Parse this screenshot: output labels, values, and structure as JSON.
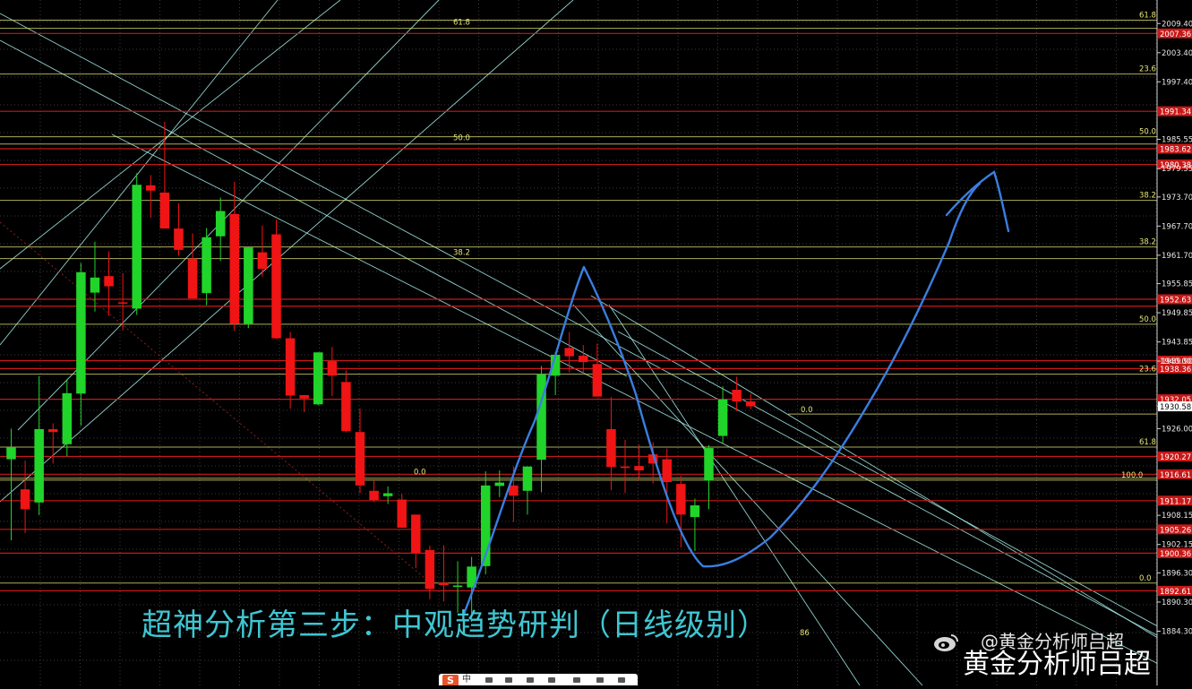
{
  "chart_data": {
    "type": "candlestick",
    "ylim": [
      1884.2,
      2012.4
    ],
    "price_ticks": [
      "2009.40",
      "2003.40",
      "1997.40",
      "1985.55",
      "1979.55",
      "1973.70",
      "1967.70",
      "1961.70",
      "1955.85",
      "1949.85",
      "1943.85",
      "1939.90",
      "1930.58",
      "1926.00",
      "1908.15",
      "1902.15",
      "1896.30",
      "1890.30",
      "1884.30"
    ],
    "red_levels": [
      {
        "value": 2007.36,
        "label": "2007.36",
        "show_label": true
      },
      {
        "value": 1991.34,
        "label": "1991.34",
        "show_label": true
      },
      {
        "value": 1983.62,
        "label": "1983.62",
        "show_label": true
      },
      {
        "value": 1980.38,
        "label": "1980.38",
        "show_label": true
      },
      {
        "value": 1952.63,
        "label": "1952.63",
        "show_label": true
      },
      {
        "value": 1951.2,
        "label": "",
        "show_label": false
      },
      {
        "value": 1940.0,
        "label": "1940.00",
        "show_label": true
      },
      {
        "value": 1938.36,
        "label": "1938.36",
        "show_label": true
      },
      {
        "value": 1932.05,
        "label": "1932.05",
        "show_label": true
      },
      {
        "value": 1920.27,
        "label": "1920.27",
        "show_label": true
      },
      {
        "value": 1916.61,
        "label": "1916.61",
        "show_label": true
      },
      {
        "value": 1911.17,
        "label": "1911.17",
        "show_label": true
      },
      {
        "value": 1905.26,
        "label": "1905.26",
        "show_label": true
      },
      {
        "value": 1900.36,
        "label": "1900.36",
        "show_label": true
      },
      {
        "value": 1892.61,
        "label": "1892.61",
        "show_label": true
      }
    ],
    "current_price": "1930.58",
    "fib_left": {
      "levels": [
        {
          "label": "61.8",
          "value": 2008.4
        },
        {
          "label": "50.0",
          "value": 1984.6
        },
        {
          "label": "38.2",
          "value": 1961.0
        },
        {
          "label": "0.0",
          "value": 1915.8
        }
      ]
    },
    "fib_right": {
      "levels": [
        {
          "label": "61.8",
          "value": 2010.1
        },
        {
          "label": "23.6",
          "value": 1999.0
        },
        {
          "label": "50.0",
          "value": 1986.1
        },
        {
          "label": "38.2",
          "value": 1973.0
        },
        {
          "label": "38.2",
          "value": 1963.4
        },
        {
          "label": "50.0",
          "value": 1947.5
        },
        {
          "label": "23.6",
          "value": 1937.2
        },
        {
          "label": "61.8",
          "value": 1922.2
        },
        {
          "label": "100.0",
          "value": 1915.4
        },
        {
          "label": "0.0",
          "value": 1894.2
        }
      ]
    },
    "fib_mid_zero": {
      "label": "0.0",
      "value": 1929.0
    },
    "fib_small_label": "86",
    "candles": [
      {
        "o": 1919.7,
        "h": 1926.0,
        "l": 1903.0,
        "c": 1922.2
      },
      {
        "o": 1913.5,
        "h": 1919.4,
        "l": 1904.5,
        "c": 1909.4
      },
      {
        "o": 1910.8,
        "h": 1936.8,
        "l": 1908.2,
        "c": 1925.9
      },
      {
        "o": 1925.9,
        "h": 1927.1,
        "l": 1918.8,
        "c": 1925.3
      },
      {
        "o": 1922.8,
        "h": 1936.2,
        "l": 1920.3,
        "c": 1933.3
      },
      {
        "o": 1933.2,
        "h": 1960.1,
        "l": 1926.6,
        "c": 1958.2
      },
      {
        "o": 1954.0,
        "h": 1964.5,
        "l": 1950.1,
        "c": 1957.1
      },
      {
        "o": 1957.4,
        "h": 1962.5,
        "l": 1949.2,
        "c": 1955.3
      },
      {
        "o": 1952.0,
        "h": 1958.0,
        "l": 1946.2,
        "c": 1951.9
      },
      {
        "o": 1950.7,
        "h": 1978.6,
        "l": 1949.4,
        "c": 1976.2
      },
      {
        "o": 1976.1,
        "h": 1978.2,
        "l": 1969.4,
        "c": 1975.0
      },
      {
        "o": 1974.6,
        "h": 1989.2,
        "l": 1968.1,
        "c": 1967.2
      },
      {
        "o": 1967.2,
        "h": 1972.4,
        "l": 1961.6,
        "c": 1962.8
      },
      {
        "o": 1961.0,
        "h": 1966.2,
        "l": 1954.3,
        "c": 1952.8
      },
      {
        "o": 1953.9,
        "h": 1967.3,
        "l": 1951.4,
        "c": 1965.4
      },
      {
        "o": 1965.6,
        "h": 1973.6,
        "l": 1960.5,
        "c": 1970.8
      },
      {
        "o": 1970.2,
        "h": 1976.8,
        "l": 1946.1,
        "c": 1947.6
      },
      {
        "o": 1947.6,
        "h": 1962.8,
        "l": 1946.7,
        "c": 1963.3
      },
      {
        "o": 1962.3,
        "h": 1967.8,
        "l": 1957.3,
        "c": 1958.9
      },
      {
        "o": 1966.0,
        "h": 1969.0,
        "l": 1944.5,
        "c": 1944.6
      },
      {
        "o": 1944.6,
        "h": 1945.9,
        "l": 1930.1,
        "c": 1932.8
      },
      {
        "o": 1932.9,
        "h": 1932.2,
        "l": 1929.4,
        "c": 1932.2
      },
      {
        "o": 1931.0,
        "h": 1940.9,
        "l": 1930.8,
        "c": 1941.7
      },
      {
        "o": 1939.9,
        "h": 1942.8,
        "l": 1932.7,
        "c": 1936.9
      },
      {
        "o": 1935.6,
        "h": 1938.0,
        "l": 1925.2,
        "c": 1925.5
      },
      {
        "o": 1925.3,
        "h": 1930.1,
        "l": 1912.7,
        "c": 1914.3
      },
      {
        "o": 1913.2,
        "h": 1915.4,
        "l": 1910.9,
        "c": 1911.3
      },
      {
        "o": 1912.1,
        "h": 1914.1,
        "l": 1910.5,
        "c": 1912.7
      },
      {
        "o": 1911.4,
        "h": 1912.6,
        "l": 1905.8,
        "c": 1905.6
      },
      {
        "o": 1908.3,
        "h": 1908.2,
        "l": 1897.3,
        "c": 1900.4
      },
      {
        "o": 1901.0,
        "h": 1901.9,
        "l": 1890.9,
        "c": 1893.0
      },
      {
        "o": 1894.3,
        "h": 1902.0,
        "l": 1890.4,
        "c": 1893.8
      },
      {
        "o": 1893.7,
        "h": 1898.7,
        "l": 1888.1,
        "c": 1893.7
      },
      {
        "o": 1893.3,
        "h": 1899.6,
        "l": 1886.2,
        "c": 1897.6
      },
      {
        "o": 1897.7,
        "h": 1917.2,
        "l": 1896.0,
        "c": 1914.3
      },
      {
        "o": 1914.2,
        "h": 1917.4,
        "l": 1911.9,
        "c": 1914.9
      },
      {
        "o": 1914.3,
        "h": 1918.2,
        "l": 1906.8,
        "c": 1912.2
      },
      {
        "o": 1913.2,
        "h": 1918.2,
        "l": 1908.3,
        "c": 1918.2
      },
      {
        "o": 1919.6,
        "h": 1938.9,
        "l": 1912.9,
        "c": 1937.2
      },
      {
        "o": 1936.9,
        "h": 1941.7,
        "l": 1932.9,
        "c": 1941.2
      },
      {
        "o": 1942.6,
        "h": 1945.9,
        "l": 1937.6,
        "c": 1940.9
      },
      {
        "o": 1941.0,
        "h": 1943.2,
        "l": 1937.2,
        "c": 1939.7
      },
      {
        "o": 1939.3,
        "h": 1943.5,
        "l": 1934.3,
        "c": 1932.6
      },
      {
        "o": 1925.9,
        "h": 1932.5,
        "l": 1913.3,
        "c": 1918.1
      },
      {
        "o": 1918.2,
        "h": 1923.7,
        "l": 1912.7,
        "c": 1917.9
      },
      {
        "o": 1918.3,
        "h": 1922.7,
        "l": 1915.3,
        "c": 1917.4
      },
      {
        "o": 1920.7,
        "h": 1923.2,
        "l": 1914.7,
        "c": 1918.8
      },
      {
        "o": 1919.7,
        "h": 1921.9,
        "l": 1906.5,
        "c": 1915.0
      },
      {
        "o": 1914.6,
        "h": 1916.3,
        "l": 1901.5,
        "c": 1908.3
      },
      {
        "o": 1907.8,
        "h": 1911.6,
        "l": 1900.8,
        "c": 1910.2
      },
      {
        "o": 1915.3,
        "h": 1922.6,
        "l": 1909.4,
        "c": 1922.0
      },
      {
        "o": 1924.5,
        "h": 1934.7,
        "l": 1923.0,
        "c": 1932.0
      },
      {
        "o": 1934.0,
        "h": 1936.7,
        "l": 1929.6,
        "c": 1931.6
      },
      {
        "o": 1931.6,
        "h": 1933.2,
        "l": 1930.0,
        "c": 1930.6
      }
    ]
  },
  "caption": "超神分析第三步：中观趋势研判（日线级别）",
  "watermark_handle": "@黄金分析师吕超",
  "watermark_big": "黄金分析师吕超",
  "ime": {
    "logo": "S",
    "label": "中"
  },
  "colors": {
    "background": "#000000",
    "bull": "#21d42a",
    "bear": "#f01414",
    "red_level": "#c81818",
    "fib_line": "#e6e678",
    "trend_line": "#a9f3ef",
    "projection": "#3a7ee0",
    "grid": "#3a3a3a",
    "caption": "#3fc6d2"
  }
}
